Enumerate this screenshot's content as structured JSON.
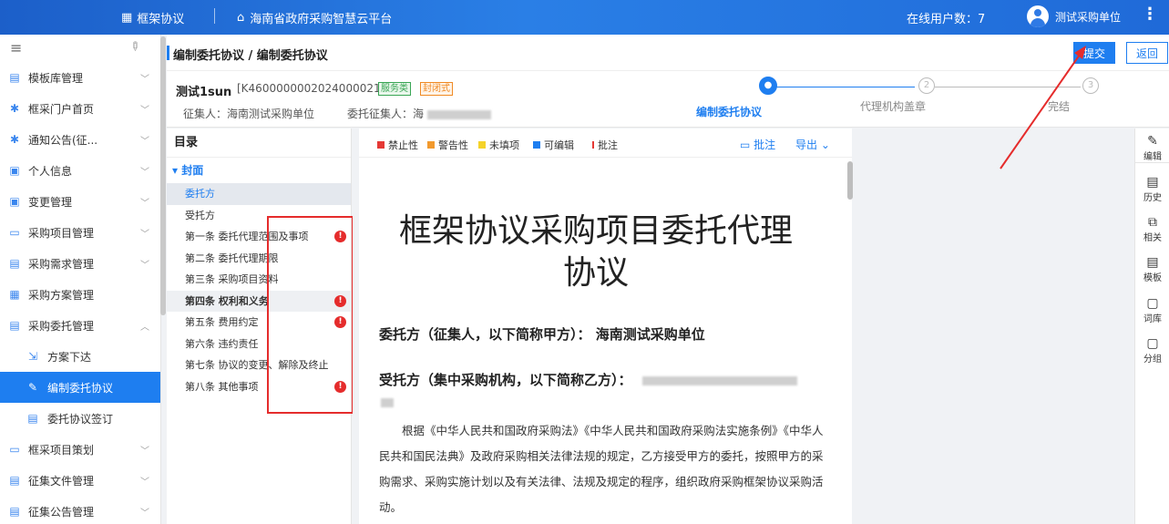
{
  "header": {
    "brand": "框架协议",
    "platform": "海南省政府采购智慧云平台",
    "online_users": "在线用户数：7",
    "user_name": "测试采购单位"
  },
  "sidebar": {
    "items": [
      {
        "label": "模板库管理",
        "icon": "template-icon"
      },
      {
        "label": "框采门户首页",
        "icon": "grid-icon"
      },
      {
        "label": "通知公告(征...",
        "icon": "grid-icon"
      },
      {
        "label": "个人信息",
        "icon": "person-card-icon"
      },
      {
        "label": "变更管理",
        "icon": "change-icon"
      },
      {
        "label": "采购项目管理",
        "icon": "folder-icon"
      },
      {
        "label": "采购需求管理",
        "icon": "document-icon"
      },
      {
        "label": "采购方案管理",
        "icon": "plan-icon"
      },
      {
        "label": "采购委托管理",
        "icon": "document-icon"
      }
    ],
    "subitems": [
      {
        "label": "方案下达",
        "icon": "issue-icon"
      },
      {
        "label": "编制委托协议",
        "icon": "edit-document-icon"
      },
      {
        "label": "委托协议签订",
        "icon": "sign-icon"
      }
    ],
    "items_after": [
      {
        "label": "框采项目策划",
        "icon": "folder-icon"
      },
      {
        "label": "征集文件管理",
        "icon": "document-icon"
      },
      {
        "label": "征集公告管理",
        "icon": "announcement-icon"
      }
    ]
  },
  "breadcrumb": "编制委托协议 / 编制委托协议",
  "buttons": {
    "submit": "提交",
    "back": "返回"
  },
  "project": {
    "name": "测试1sun",
    "code": "[K4600000002024000021]",
    "tag_type": "服务类",
    "tag_status": "封闭式",
    "collector_label": "征集人：海南测试采购单位",
    "delegate_label": "委托征集人：海"
  },
  "steps": [
    {
      "num": "1",
      "label": "编制委托协议",
      "active": true
    },
    {
      "num": "2",
      "label": "代理机构盖章",
      "active": false
    },
    {
      "num": "3",
      "label": "完结",
      "active": false
    }
  ],
  "toc": {
    "heading": "目录",
    "section": "封面",
    "items": [
      {
        "label": "委托方",
        "error": false
      },
      {
        "label": "受托方",
        "error": false
      },
      {
        "label": "第一条 委托代理范围及事项",
        "error": true
      },
      {
        "label": "第二条 委托代理期限",
        "error": false
      },
      {
        "label": "第三条 采购项目资料",
        "error": false
      },
      {
        "label": "第四条 权利和义务",
        "error": true
      },
      {
        "label": "第五条 费用约定",
        "error": true
      },
      {
        "label": "第六条 违约责任",
        "error": false
      },
      {
        "label": "第七条 协议的变更、解除及终止",
        "error": false
      },
      {
        "label": "第八条 其他事项",
        "error": true
      }
    ]
  },
  "legend": {
    "items": [
      {
        "label": "禁止性",
        "color": "#e53935"
      },
      {
        "label": "警告性",
        "color": "#f29a2e"
      },
      {
        "label": "未填项",
        "color": "#f5d32a"
      },
      {
        "label": "可编辑",
        "color": "#1e7ef0"
      },
      {
        "label": "批注",
        "color": "#e53935"
      }
    ],
    "comment": "批注",
    "export": "导出"
  },
  "document": {
    "title_line1": "框架协议采购项目委托代理",
    "title_line2": "协议",
    "client_line": "委托方（征集人，以下简称甲方）：  海南测试采购单位",
    "agent_line": "受托方（集中采购机构，以下简称乙方）：",
    "paragraph": "根据《中华人民共和国政府采购法》《中华人民共和国政府采购法实施条例》《中华人民共和国民法典》及政府采购相关法律法规的规定，乙方接受甲方的委托，按照甲方的采购需求、采购实施计划以及有关法律、法规及规定的程序，组织政府采购框架协议采购活动。"
  },
  "tools": [
    {
      "label": "编辑",
      "icon": "pen-icon"
    },
    {
      "label": "历史",
      "icon": "history-icon"
    },
    {
      "label": "相关",
      "icon": "related-icon"
    },
    {
      "label": "模板",
      "icon": "template-icon"
    },
    {
      "label": "词库",
      "icon": "lexicon-icon"
    },
    {
      "label": "分组",
      "icon": "group-icon"
    }
  ],
  "colors": {
    "accent": "#1e7ef0",
    "error": "#e52c2c",
    "annotation": "#e52c2c"
  }
}
